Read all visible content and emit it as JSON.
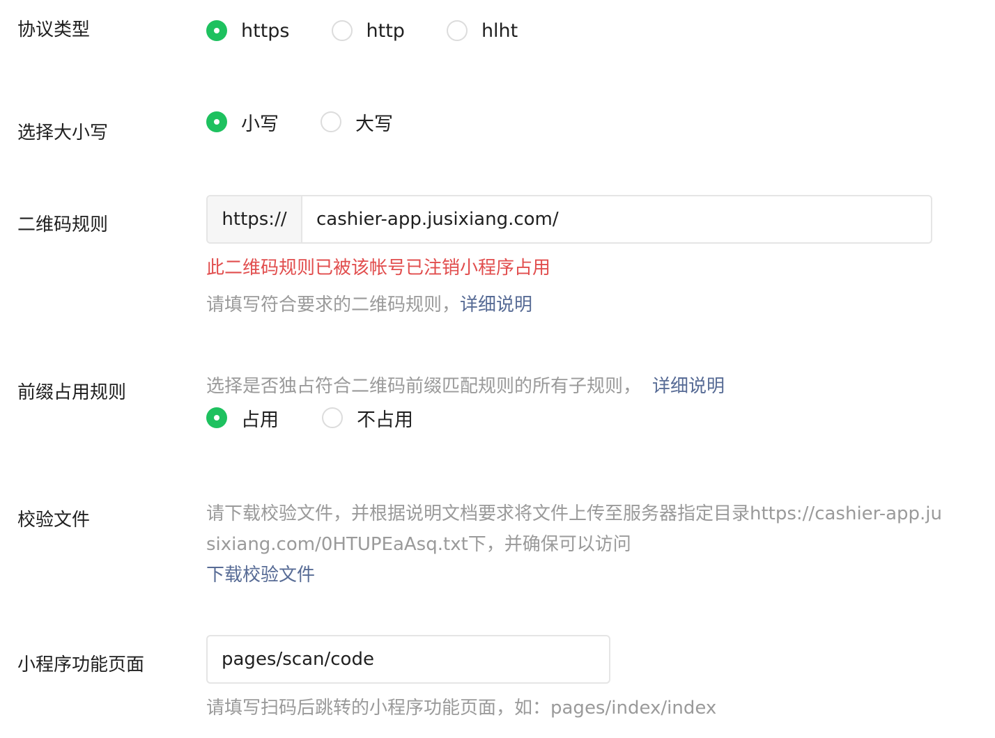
{
  "protocol": {
    "label": "协议类型",
    "options": [
      {
        "text": "https",
        "checked": true
      },
      {
        "text": "http",
        "checked": false
      },
      {
        "text": "hlht",
        "checked": false
      }
    ]
  },
  "case": {
    "label": "选择大小写",
    "options": [
      {
        "text": "小写",
        "checked": true
      },
      {
        "text": "大写",
        "checked": false
      }
    ]
  },
  "qr_rule": {
    "label": "二维码规则",
    "prefix": "https://",
    "value": "cashier-app.jusixiang.com/",
    "error": "此二维码规则已被该帐号已注销小程序占用",
    "hint": "请填写符合要求的二维码规则，",
    "hint_link": "详细说明"
  },
  "prefix_rule": {
    "label": "前缀占用规则",
    "hint": "选择是否独占符合二维码前缀匹配规则的所有子规则，",
    "hint_link": "详细说明",
    "options": [
      {
        "text": "占用",
        "checked": true
      },
      {
        "text": "不占用",
        "checked": false
      }
    ]
  },
  "verify_file": {
    "label": "校验文件",
    "description": "请下载校验文件，并根据说明文档要求将文件上传至服务器指定目录https://cashier-app.jusixiang.com/0HTUPEaAsq.txt下，并确保可以访问",
    "download_link": "下载校验文件"
  },
  "function_page": {
    "label": "小程序功能页面",
    "value": "pages/scan/code",
    "hint": "请填写扫码后跳转的小程序功能页面，如：pages/index/index"
  },
  "colors": {
    "accent": "#1ec15f",
    "error": "#e14d4d",
    "link": "#576b95",
    "hint": "#9a9a9a"
  }
}
